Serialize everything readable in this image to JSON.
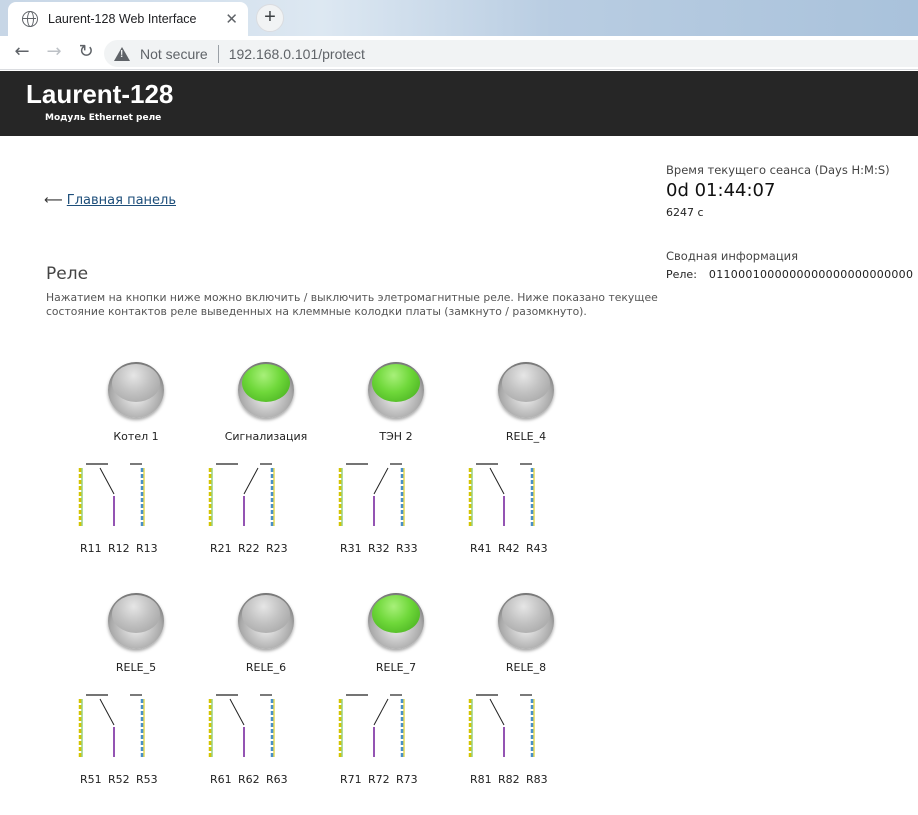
{
  "browser": {
    "tab_title": "Laurent-128 Web Interface",
    "tab_close": "✕",
    "new_tab": "+",
    "back": "←",
    "forward": "→",
    "reload": "↻",
    "security_label": "Not secure",
    "url": "192.168.0.101/protect"
  },
  "header": {
    "brand": "Laurent-128",
    "subtitle": "Модуль Ethernet реле"
  },
  "nav": {
    "arrow": "⟵",
    "back_link": "Главная панель"
  },
  "session": {
    "label": "Время текущего сеанса (Days H:M:S)",
    "time": "0d 01:44:07",
    "seconds": "6247 с"
  },
  "summary": {
    "label": "Сводная информация",
    "relay_label": "Реле:",
    "relay_bits": "0110001000000000000000000000"
  },
  "section": {
    "title": "Реле",
    "description": "Нажатием на кнопки ниже можно включить / выключить элетромагнитные реле. Ниже показано текущее состояние контактов реле выведенных на клеммные колодки платы (замкнуто / разомкнуто)."
  },
  "colors": {
    "header_bg": "#262626",
    "on": "#6fd83a",
    "off": "#c2c2c2",
    "wire_yellow": "#d4c400",
    "wire_green": "#66bb44",
    "wire_blue": "#4a90c8",
    "wire_purple": "#7a2aa0"
  },
  "relays": [
    {
      "name": "Котел 1",
      "on": false,
      "terms": [
        "R11",
        "R12",
        "R13"
      ]
    },
    {
      "name": "Сигнализация",
      "on": true,
      "terms": [
        "R21",
        "R22",
        "R23"
      ]
    },
    {
      "name": "ТЭН 2",
      "on": true,
      "terms": [
        "R31",
        "R32",
        "R33"
      ]
    },
    {
      "name": "RELE_4",
      "on": false,
      "terms": [
        "R41",
        "R42",
        "R43"
      ]
    },
    {
      "name": "RELE_5",
      "on": false,
      "terms": [
        "R51",
        "R52",
        "R53"
      ]
    },
    {
      "name": "RELE_6",
      "on": false,
      "terms": [
        "R61",
        "R62",
        "R63"
      ]
    },
    {
      "name": "RELE_7",
      "on": true,
      "terms": [
        "R71",
        "R72",
        "R73"
      ]
    },
    {
      "name": "RELE_8",
      "on": false,
      "terms": [
        "R81",
        "R82",
        "R83"
      ]
    }
  ]
}
